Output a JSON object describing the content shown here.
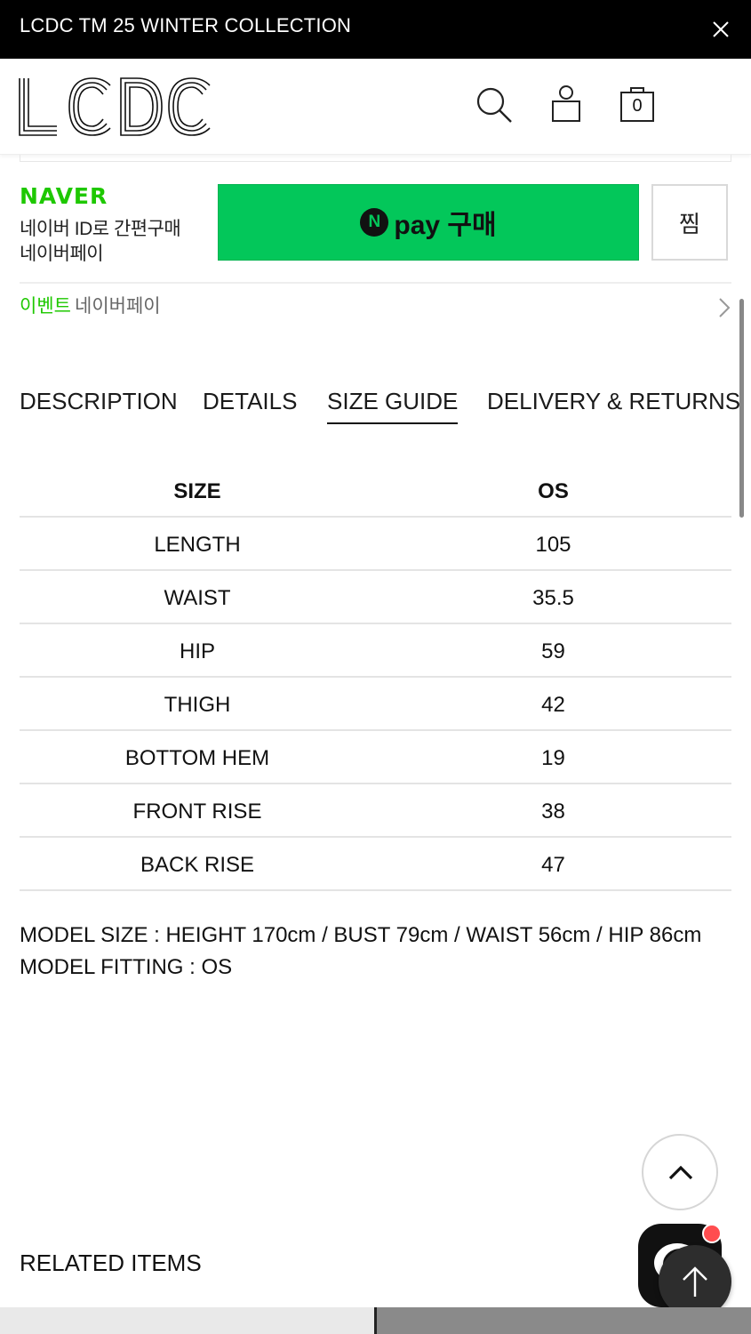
{
  "announcement": {
    "text": "LCDC TM 25 WINTER COLLECTION"
  },
  "header": {
    "brand": "LCDC",
    "cart_count": "0"
  },
  "naver_pay": {
    "brand": "NAVER",
    "line1": "네이버 ID로 간편구매",
    "line2": "네이버페이",
    "button_n": "N",
    "button_label": "pay 구매",
    "zzim_label": "찜",
    "event_label": "이벤트",
    "event_text": "네이버페이"
  },
  "tabs": [
    {
      "label": "DESCRIPTION"
    },
    {
      "label": "DETAILS"
    },
    {
      "label": "SIZE GUIDE",
      "active": true
    },
    {
      "label": "DELIVERY & RETURNS"
    }
  ],
  "size_table": {
    "header": [
      "SIZE",
      "OS"
    ],
    "rows": [
      [
        "LENGTH",
        "105"
      ],
      [
        "WAIST",
        "35.5"
      ],
      [
        "HIP",
        "59"
      ],
      [
        "THIGH",
        "42"
      ],
      [
        "BOTTOM HEM",
        "19"
      ],
      [
        "FRONT RISE",
        "38"
      ],
      [
        "BACK RISE",
        "47"
      ]
    ]
  },
  "model": {
    "size": "MODEL SIZE : HEIGHT 170cm / BUST 79cm / WAIST 56cm / HIP 86cm",
    "fitting": "MODEL FITTING : OS"
  },
  "related": {
    "title": "RELATED ITEMS"
  },
  "icons": {
    "close": "close-icon",
    "search": "search-icon",
    "account": "user-icon",
    "cart": "shopping-bag-icon",
    "up": "chevron-up-icon",
    "arrow_up": "arrow-up-icon",
    "chat": "chat-icon",
    "chevron_right": "chevron-right-icon"
  },
  "colors": {
    "naver_green": "#03c75a",
    "naver_text_green": "#1ec800",
    "announce_bg": "#000000"
  }
}
